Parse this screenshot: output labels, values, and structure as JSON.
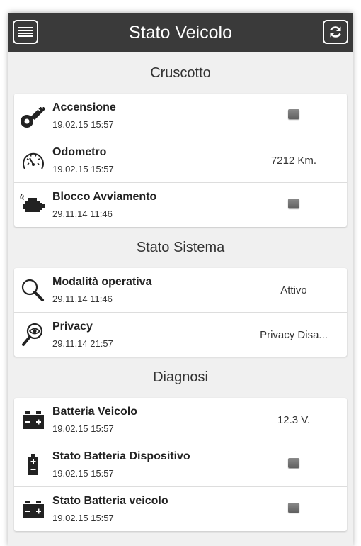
{
  "header": {
    "title": "Stato Veicolo",
    "menu_icon": "hamburger-menu-icon",
    "refresh_icon": "refresh-icon"
  },
  "sections": [
    {
      "title": "Cruscotto",
      "items": [
        {
          "icon": "key-icon",
          "title": "Accensione",
          "time": "19.02.15 15:57",
          "value": "",
          "indicator": true
        },
        {
          "icon": "speedometer-icon",
          "title": "Odometro",
          "time": "19.02.15 15:57",
          "value": "7212 Km.",
          "indicator": false
        },
        {
          "icon": "engine-icon",
          "title": "Blocco Avviamento",
          "time": "29.11.14 11:46",
          "value": "",
          "indicator": true
        }
      ]
    },
    {
      "title": "Stato Sistema",
      "items": [
        {
          "icon": "magnifier-icon",
          "title": "Modalità operativa",
          "time": "29.11.14 11:46",
          "value": "Attivo",
          "indicator": false
        },
        {
          "icon": "eye-magnifier-icon",
          "title": "Privacy",
          "time": "29.11.14 21:57",
          "value": "Privacy Disa...",
          "indicator": false
        }
      ]
    },
    {
      "title": "Diagnosi",
      "items": [
        {
          "icon": "car-battery-icon",
          "title": "Batteria Veicolo",
          "time": "19.02.15 15:57",
          "value": "12.3 V.",
          "indicator": false
        },
        {
          "icon": "device-battery-icon",
          "title": "Stato Batteria Dispositivo",
          "time": "19.02.15 15:57",
          "value": "",
          "indicator": true
        },
        {
          "icon": "car-battery-icon",
          "title": "Stato Batteria veicolo",
          "time": "19.02.15 15:57",
          "value": "",
          "indicator": true
        }
      ]
    }
  ],
  "colors": {
    "header_bg": "#3a3a3a",
    "indicator": "#707070",
    "background": "#f0f0f0"
  }
}
